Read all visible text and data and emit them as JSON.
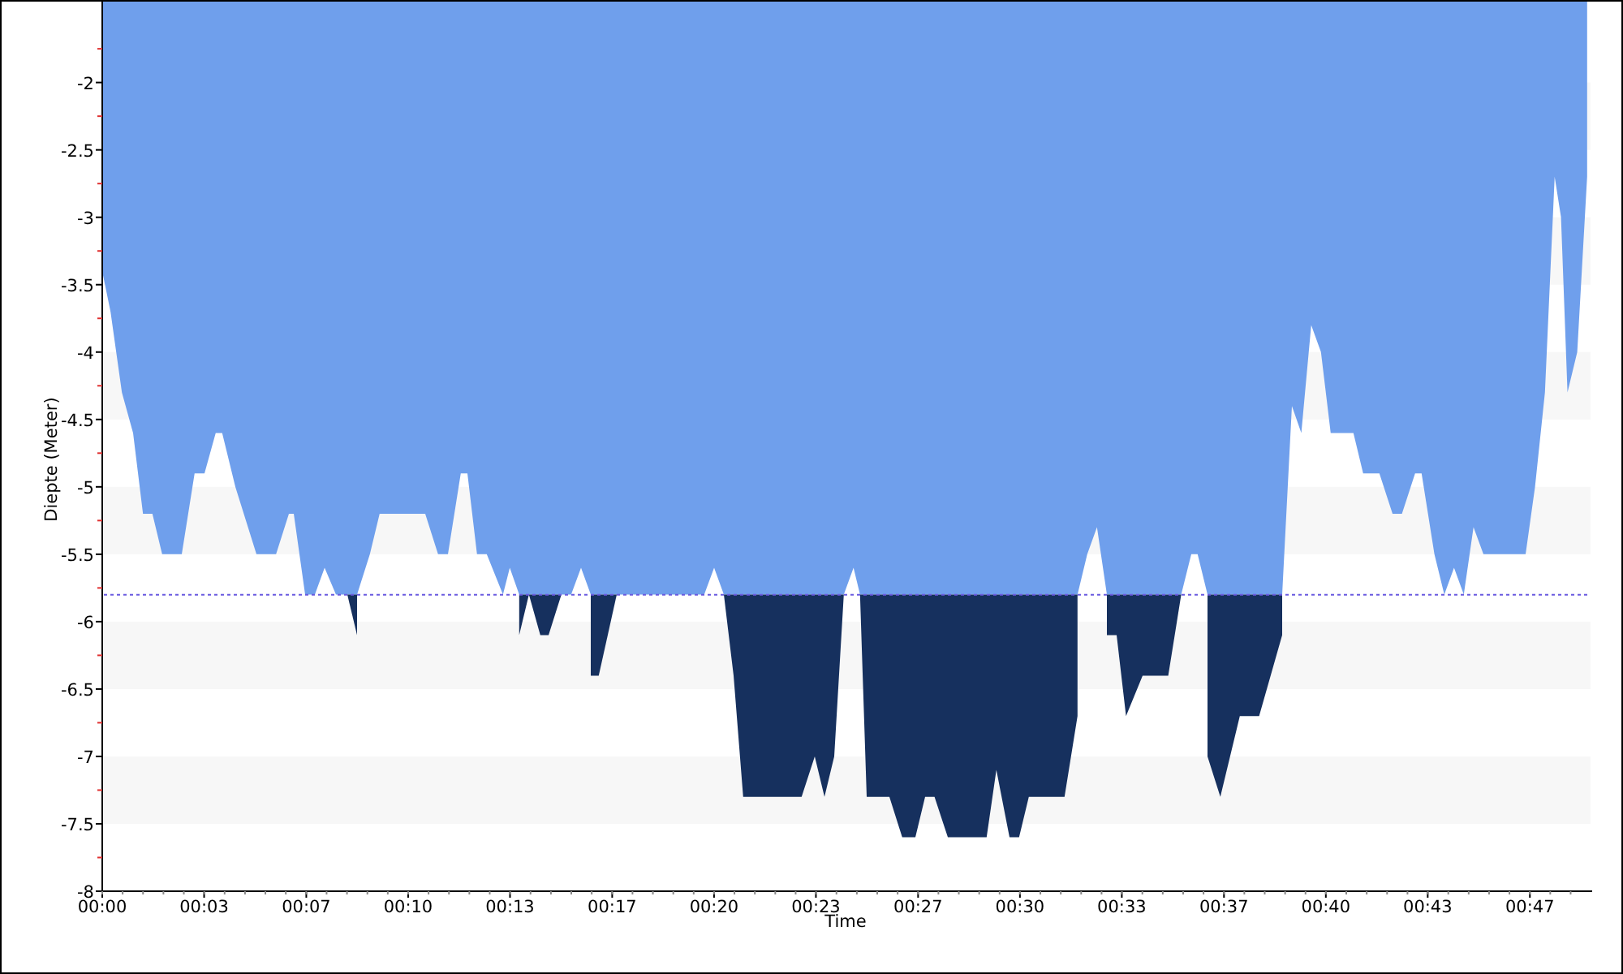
{
  "chart": {
    "chart_data": {
      "type": "area",
      "xlabel": "Time",
      "ylabel": "Diepte (Meter)",
      "xlim": [
        0,
        48.6
      ],
      "ylim": [
        -8,
        -1.4
      ],
      "xticks": [
        {
          "value": 0,
          "label": "00:00"
        },
        {
          "value": 3.33,
          "label": "00:03"
        },
        {
          "value": 6.67,
          "label": "00:07"
        },
        {
          "value": 10,
          "label": "00:10"
        },
        {
          "value": 13.33,
          "label": "00:13"
        },
        {
          "value": 16.67,
          "label": "00:17"
        },
        {
          "value": 20,
          "label": "00:20"
        },
        {
          "value": 23.33,
          "label": "00:23"
        },
        {
          "value": 26.67,
          "label": "00:27"
        },
        {
          "value": 30,
          "label": "00:30"
        },
        {
          "value": 33.33,
          "label": "00:33"
        },
        {
          "value": 36.67,
          "label": "00:37"
        },
        {
          "value": 40,
          "label": "00:40"
        },
        {
          "value": 43.33,
          "label": "00:43"
        },
        {
          "value": 46.67,
          "label": "00:47"
        }
      ],
      "yticks": [
        {
          "value": -8,
          "label": "-8"
        },
        {
          "value": -7.5,
          "label": "-7.5"
        },
        {
          "value": -7,
          "label": "-7"
        },
        {
          "value": -6.5,
          "label": "-6.5"
        },
        {
          "value": -6,
          "label": "-6"
        },
        {
          "value": -5.5,
          "label": "-5.5"
        },
        {
          "value": -5,
          "label": "-5"
        },
        {
          "value": -4.5,
          "label": "-4.5"
        },
        {
          "value": -4,
          "label": "-4"
        },
        {
          "value": -3.5,
          "label": "-3.5"
        },
        {
          "value": -3,
          "label": "-3"
        },
        {
          "value": -2.5,
          "label": "-2.5"
        },
        {
          "value": -2,
          "label": "-2"
        }
      ],
      "x": [
        0,
        0.27,
        0.64,
        1.01,
        1.33,
        1.64,
        1.96,
        2.6,
        3.02,
        3.34,
        3.71,
        3.92,
        4.35,
        5.04,
        5.68,
        6.1,
        6.26,
        6.63,
        6.95,
        7.27,
        7.64,
        8.01,
        8.33,
        8.75,
        9.07,
        10.56,
        10.98,
        11.3,
        11.72,
        11.94,
        12.25,
        12.57,
        13.1,
        13.32,
        13.63,
        13.95,
        14.32,
        14.59,
        15.01,
        15.33,
        15.65,
        15.97,
        16.23,
        16.82,
        19.68,
        20.0,
        20.32,
        20.64,
        20.95,
        22.86,
        23.29,
        23.61,
        23.93,
        24.24,
        24.56,
        24.77,
        24.99,
        25.73,
        26.15,
        26.58,
        26.9,
        27.21,
        27.64,
        28.91,
        29.23,
        29.66,
        29.97,
        30.29,
        31.46,
        31.88,
        32.2,
        32.52,
        32.84,
        33.16,
        33.47,
        34.01,
        34.85,
        35.27,
        35.6,
        35.81,
        36.13,
        36.55,
        37.19,
        37.82,
        38.57,
        38.89,
        39.2,
        39.52,
        39.84,
        40.16,
        40.9,
        41.22,
        41.75,
        42.18,
        42.49,
        42.92,
        43.13,
        43.55,
        43.87,
        44.19,
        44.51,
        44.83,
        45.15,
        46.53,
        46.84,
        47.16,
        47.48,
        47.69,
        47.9,
        48.22,
        48.54
      ],
      "series": [
        {
          "color": "#6f9fec",
          "values": [
            -3.4,
            -3.7,
            -4.3,
            -4.6,
            -5.2,
            -5.2,
            -5.5,
            -5.5,
            -4.9,
            -4.9,
            -4.6,
            -4.6,
            -5.0,
            -5.5,
            -5.5,
            -5.2,
            -5.2,
            -5.8,
            -5.8,
            -5.6,
            -5.8,
            -5.8,
            -5.8,
            -5.5,
            -5.2,
            -5.2,
            -5.5,
            -5.5,
            -4.9,
            -4.9,
            -5.5,
            -5.5,
            -5.8,
            -5.6,
            -5.8,
            -5.8,
            -5.8,
            -5.8,
            -5.8,
            -5.8,
            -5.6,
            -5.8,
            -5.8,
            -5.8,
            -5.8,
            -5.6,
            -5.8,
            -5.8,
            -5.8,
            -5.8,
            -5.8,
            -5.8,
            -5.8,
            -5.8,
            -5.6,
            -5.8,
            -5.8,
            -5.8,
            -5.8,
            -5.8,
            -5.8,
            -5.8,
            -5.8,
            -5.8,
            -5.8,
            -5.8,
            -5.8,
            -5.8,
            -5.8,
            -5.8,
            -5.5,
            -5.3,
            -5.8,
            -5.8,
            -5.8,
            -5.8,
            -5.8,
            -5.8,
            -5.5,
            -5.5,
            -5.8,
            -5.8,
            -5.8,
            -5.8,
            -5.8,
            -4.4,
            -4.6,
            -3.8,
            -4.0,
            -4.6,
            -4.6,
            -4.9,
            -4.9,
            -5.2,
            -5.2,
            -4.9,
            -4.9,
            -5.5,
            -5.8,
            -5.6,
            -5.8,
            -5.3,
            -5.5,
            -5.5,
            -5.0,
            -4.3,
            -2.7,
            -3.0,
            -4.3,
            -4.0,
            -2.7
          ]
        },
        {
          "color": "#16305e",
          "values": [
            null,
            null,
            null,
            null,
            null,
            null,
            null,
            null,
            null,
            null,
            null,
            null,
            null,
            null,
            null,
            null,
            null,
            null,
            null,
            null,
            null,
            -5.8,
            -6.1,
            null,
            null,
            null,
            null,
            null,
            null,
            null,
            null,
            null,
            null,
            null,
            -6.1,
            -5.8,
            -6.1,
            -6.1,
            -5.8,
            null,
            null,
            -6.4,
            -6.4,
            -5.8,
            null,
            null,
            -5.8,
            -6.4,
            -7.3,
            -7.3,
            -7.0,
            -7.3,
            -7.0,
            -5.8,
            null,
            -5.8,
            -7.3,
            -7.3,
            -7.6,
            -7.6,
            -7.3,
            -7.3,
            -7.6,
            -7.6,
            -7.1,
            -7.6,
            -7.6,
            -7.3,
            -7.3,
            -6.7,
            null,
            null,
            -6.1,
            -6.1,
            -6.7,
            -6.4,
            -6.4,
            -5.8,
            null,
            null,
            -7.0,
            -7.3,
            -6.7,
            -6.7,
            -6.1,
            null,
            null,
            null,
            null,
            null,
            null,
            null,
            null,
            null,
            null,
            null,
            null,
            null,
            null,
            null,
            null,
            null,
            null,
            null,
            null,
            null,
            null,
            null,
            null,
            null,
            null
          ]
        }
      ],
      "ref_lines": [
        {
          "axis": "y",
          "value": -5.8
        }
      ]
    }
  }
}
